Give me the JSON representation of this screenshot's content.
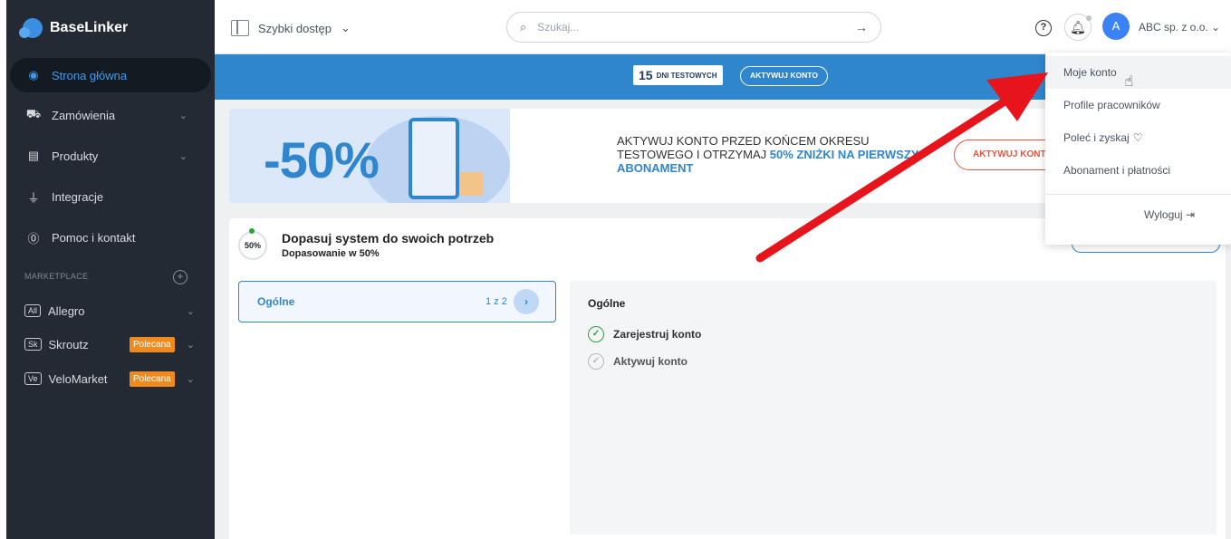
{
  "sidebar": {
    "brand": "BaseLinker",
    "items": [
      {
        "label": "Strona główna",
        "icon": "dashboard-icon"
      },
      {
        "label": "Zamówienia",
        "icon": "cart-icon"
      },
      {
        "label": "Produkty",
        "icon": "products-icon"
      },
      {
        "label": "Integracje",
        "icon": "plug-icon"
      },
      {
        "label": "Pomoc i kontakt",
        "icon": "help-icon"
      }
    ],
    "marketplace_heading": "MARKETPLACE",
    "marketplace": [
      {
        "tag": "All",
        "label": "Allegro",
        "badge": ""
      },
      {
        "tag": "Sk",
        "label": "Skroutz",
        "badge": "Polecana"
      },
      {
        "tag": "Ve",
        "label": "VeloMarket",
        "badge": "Polecana"
      }
    ]
  },
  "topbar": {
    "quick_access": "Szybki dostęp",
    "search_placeholder": "Szukaj...",
    "company": "ABC sp. z o.o.",
    "avatar_letter": "A"
  },
  "trial": {
    "days": "15",
    "days_label": "DNI TESTOWYCH",
    "activate": "AKTYWUJ KONTO"
  },
  "promo": {
    "discount": "-50%",
    "text_plain": "AKTYWUJ KONTO PRZED KOŃCEM OKRESU TESTOWEGO I OTRZYMAJ ",
    "text_highlight": "50% ZNIŻKI NA PIERWSZY ABONAMENT",
    "button": "AKTYWUJ KONTO"
  },
  "setup": {
    "percent": "50%",
    "title": "Dopasuj system do swoich potrzeb",
    "subtitle": "Dopasowanie w 50%",
    "category": "Ogólne",
    "category_count": "1 z 2",
    "detail_title": "Ogólne",
    "tasks": [
      {
        "label": "Zarejestruj konto",
        "done": true
      },
      {
        "label": "Aktywuj konto",
        "done": false
      }
    ]
  },
  "dropdown": {
    "items": [
      "Moje konto",
      "Profile pracowników",
      "Poleć i zyskaj",
      "Abonament i płatności"
    ],
    "logout": "Wyloguj"
  },
  "colors": {
    "accent": "#2f86cd",
    "sidebar": "#232a33",
    "badge": "#f08a1c",
    "annotation_arrow": "#e8141b"
  }
}
